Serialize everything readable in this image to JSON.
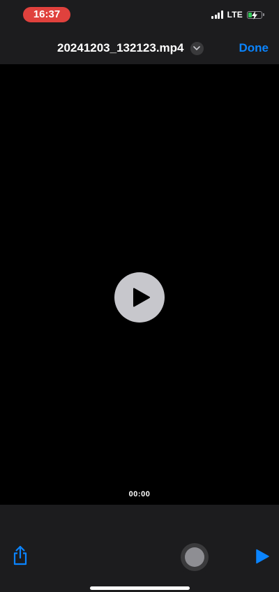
{
  "status_bar": {
    "time": "16:37",
    "network": "LTE",
    "signal_icon": "signal-bars-icon",
    "battery_icon": "battery-charging-icon",
    "time_pill_color": "#e0413d",
    "battery_level": 0.3
  },
  "nav": {
    "title": "20241203_132123.mp4",
    "title_menu_icon": "chevron-down-icon",
    "done_label": "Done",
    "accent_color": "#0a84ff"
  },
  "video": {
    "current_time": "00:00",
    "overlay_icon": "play-icon"
  },
  "toolbar": {
    "share_icon": "share-icon",
    "assistive_touch_icon": "assistive-touch-icon",
    "play_icon": "play-icon"
  }
}
